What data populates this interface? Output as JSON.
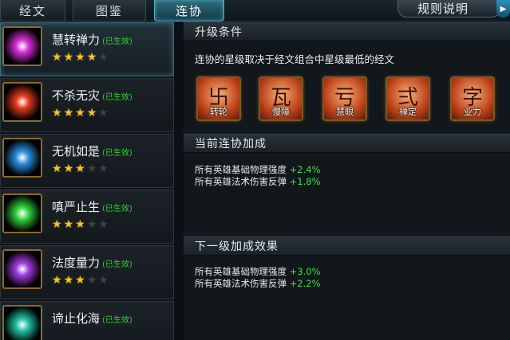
{
  "tabs": [
    {
      "label": "经文"
    },
    {
      "label": "图鉴"
    },
    {
      "label": "连协"
    }
  ],
  "rules_button": {
    "label": "规则说明",
    "arrow": "▶"
  },
  "colors": {
    "accent": "#5fb3c8",
    "status_green": "#35d23a",
    "star": "#f2c232",
    "icon_border": "#8a6a2a"
  },
  "list": [
    {
      "name": "慧转禅力",
      "status": "(已生效)",
      "stars": 4,
      "max_stars": 5,
      "icon": "magenta-nebula-icon",
      "orb": "#d62ed6",
      "selected": true
    },
    {
      "name": "不杀无灾",
      "status": "(已生效)",
      "stars": 4,
      "max_stars": 5,
      "icon": "red-nebula-icon",
      "orb": "#e23a1c",
      "selected": false
    },
    {
      "name": "无机如是",
      "status": "(已生效)",
      "stars": 3,
      "max_stars": 5,
      "icon": "blue-nebula-icon",
      "orb": "#2a8fe0",
      "selected": false
    },
    {
      "name": "嗔严止生",
      "status": "(已生效)",
      "stars": 3,
      "max_stars": 5,
      "icon": "green-nebula-icon",
      "orb": "#2fd43a",
      "selected": false
    },
    {
      "name": "法度量力",
      "status": "(已生效)",
      "stars": 3,
      "max_stars": 5,
      "icon": "purple-nebula-icon",
      "orb": "#a03ae0",
      "selected": false
    },
    {
      "name": "谛止化海",
      "status": "(已生效)",
      "stars": 0,
      "max_stars": 5,
      "icon": "teal-nebula-icon",
      "orb": "#1fbfa0",
      "selected": false
    }
  ],
  "upgrade": {
    "heading": "升级条件",
    "description": "连协的星级取决于经文组合中星级最低的经文",
    "cards": [
      {
        "label": "转轮",
        "glyph": "卐",
        "icon": "sutra-rune-icon"
      },
      {
        "label": "慢障",
        "glyph": "瓦",
        "icon": "sutra-rune-icon"
      },
      {
        "label": "慧眼",
        "glyph": "亏",
        "icon": "sutra-rune-icon"
      },
      {
        "label": "禅定",
        "glyph": "弍",
        "icon": "sutra-rune-icon"
      },
      {
        "label": "业力",
        "glyph": "字",
        "icon": "sutra-rune-icon"
      }
    ]
  },
  "current": {
    "heading": "当前连协加成",
    "lines": [
      {
        "text": "所有英雄基础物理强度",
        "value": "+2.4%"
      },
      {
        "text": "所有英雄法术伤害反弹",
        "value": "+1.8%"
      }
    ]
  },
  "next": {
    "heading": "下一级加成效果",
    "lines": [
      {
        "text": "所有英雄基础物理强度",
        "value": "+3.0%"
      },
      {
        "text": "所有英雄法术伤害反弹",
        "value": "+2.2%"
      }
    ]
  }
}
